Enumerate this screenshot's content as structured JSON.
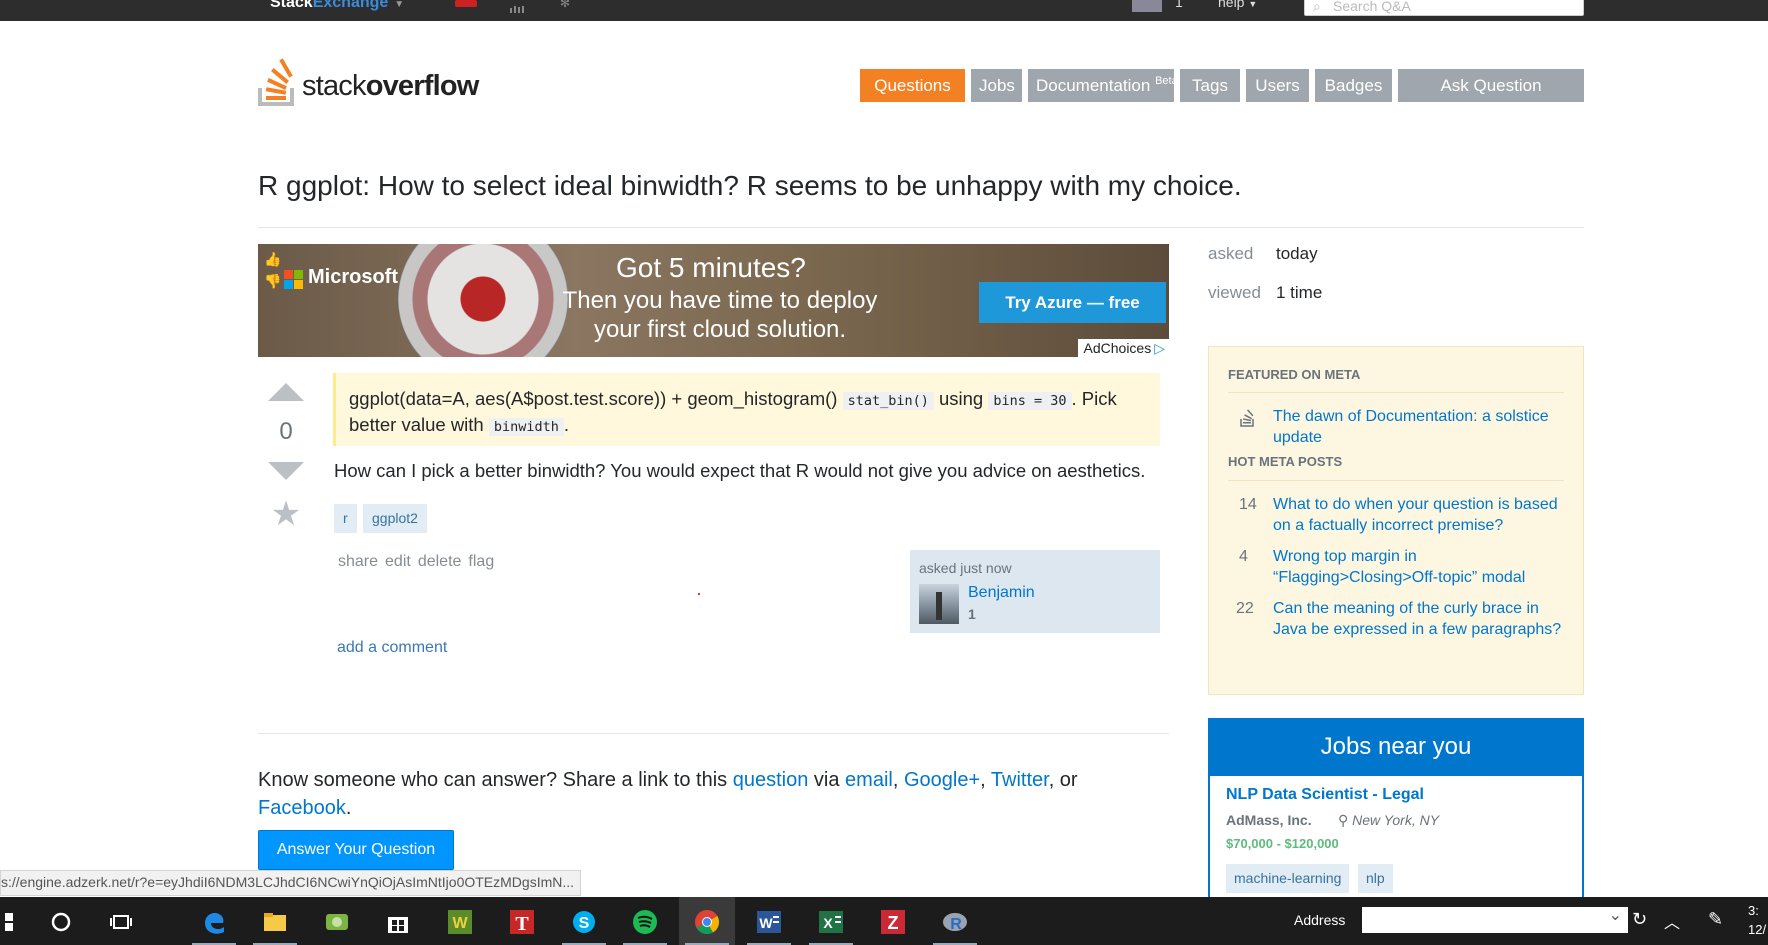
{
  "topbar": {
    "brand_stack": "Stack",
    "brand_exchange": "Exchange",
    "rep": "1",
    "help": "help",
    "search_placeholder": "Search Q&A"
  },
  "logo": {
    "text_light": "stack",
    "text_bold": "overflow"
  },
  "nav": {
    "questions": "Questions",
    "jobs": "Jobs",
    "documentation": "Documentation",
    "documentation_badge": "Beta",
    "tags": "Tags",
    "users": "Users",
    "badges": "Badges",
    "ask": "Ask Question"
  },
  "question": {
    "title": "R ggplot: How to select ideal binwidth? R seems to be unhappy with my choice.",
    "votes": "0",
    "quote_part1": "ggplot(data=A, aes(A$post.test.score)) + geom_histogram() ",
    "quote_code1": "stat_bin()",
    "quote_part2": " using ",
    "quote_code2": "bins = 30",
    "quote_part3": ". Pick better value with ",
    "quote_code3": "binwidth",
    "quote_part4": ".",
    "body": "How can I pick a better binwidth? You would expect that R would not give you advice on aesthetics.",
    "tags": [
      "r",
      "ggplot2"
    ],
    "menu": [
      "share",
      "edit",
      "delete",
      "flag"
    ],
    "asked_label": "asked just now",
    "owner_name": "Benjamin",
    "owner_rep": "1",
    "add_comment": "add a comment"
  },
  "ad": {
    "brand": "Microsoft",
    "headline": "Got 5 minutes?",
    "subline": "Then you have time to deploy your first cloud solution.",
    "cta": "Try Azure — free",
    "choices": "AdChoices"
  },
  "share": {
    "prefix": "Know someone who can answer? Share a link to this ",
    "question": "question",
    "via": " via ",
    "email": "email",
    "comma1": ", ",
    "google": "Google+",
    "comma2": ", ",
    "twitter": "Twitter",
    "or": ", or ",
    "facebook": "Facebook",
    "period": "."
  },
  "answer_button": "Answer Your Question",
  "status_url": "s://engine.adzerk.net/r?e=eyJhdiI6NDM3LCJhdCI6NCwiYnQiOjAsImNtIjo0OTEzMDgsImN...",
  "sidebar": {
    "asked_label": "asked",
    "asked_value": "today",
    "viewed_label": "viewed",
    "viewed_value": "1 time",
    "featured_heading": "FEATURED ON META",
    "featured_item": "The dawn of Documentation: a solstice update",
    "hot_heading": "HOT META POSTS",
    "hot": [
      {
        "count": "14",
        "title": "What to do when your question is based on a factually incorrect premise?"
      },
      {
        "count": "4",
        "title": "Wrong top margin in “Flagging>Closing>Off-topic” modal"
      },
      {
        "count": "22",
        "title": "Can the meaning of the curly brace in Java be expressed in a few paragraphs?"
      }
    ],
    "jobs_heading": "Jobs near you",
    "job_title": "NLP Data Scientist - Legal",
    "job_company": "AdMass, Inc.",
    "job_location": "New York, NY",
    "job_salary": "$70,000 - $120,000",
    "job_tags": [
      "machine-learning",
      "nlp"
    ]
  },
  "taskbar": {
    "address_label": "Address",
    "clock_top": "3:",
    "clock_bottom": "12/"
  },
  "colors": {
    "accent": "#f48024",
    "link": "#0077cc",
    "nav_grey": "#9fa6ad"
  }
}
